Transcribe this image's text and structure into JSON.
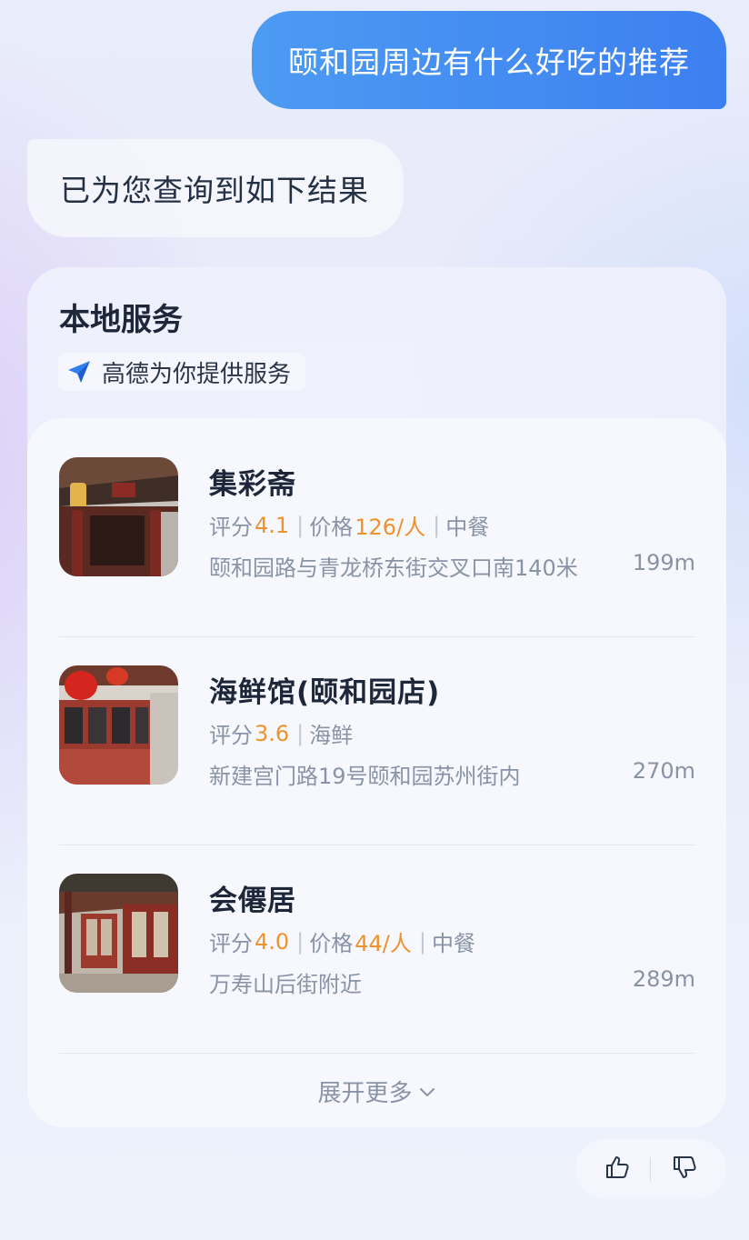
{
  "user_message": "颐和园周边有什么好吃的推荐",
  "bot_message": "已为您查询到如下结果",
  "card": {
    "title": "本地服务",
    "provider": "高德为你提供服务",
    "items": [
      {
        "name": "集彩斋",
        "rating_label": "评分",
        "rating": "4.1",
        "price_label": "价格",
        "price": "126/人",
        "category": "中餐",
        "address": "颐和园路与青龙桥东街交叉口南140米",
        "distance": "199m"
      },
      {
        "name": "海鲜馆(颐和园店)",
        "rating_label": "评分",
        "rating": "3.6",
        "category": "海鲜",
        "address": "新建宫门路19号颐和园苏州街内",
        "distance": "270m"
      },
      {
        "name": "会僊居",
        "rating_label": "评分",
        "rating": "4.0",
        "price_label": "价格",
        "price": "44/人",
        "category": "中餐",
        "address": "万寿山后街附近",
        "distance": "289m"
      }
    ],
    "more_label": "展开更多"
  },
  "icons": {
    "provider": "amap-navigation-icon",
    "more": "chevron-down-icon",
    "like": "thumbs-up-icon",
    "dislike": "thumbs-down-icon"
  },
  "colors": {
    "user_bubble_start": "#4c9bf2",
    "user_bubble_end": "#3d7ff0",
    "highlight": "#f0922c",
    "muted_text": "#8a93a5"
  }
}
